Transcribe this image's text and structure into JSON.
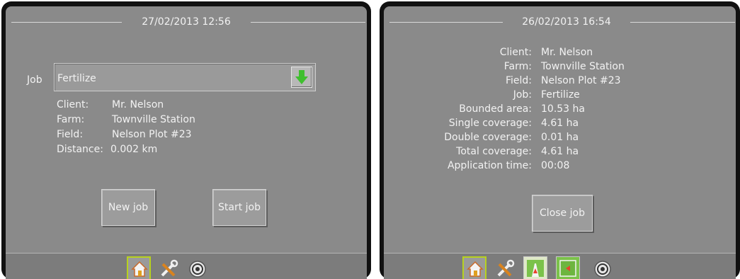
{
  "left_screen": {
    "title": "27/02/2013 12:56",
    "job_label": "Job",
    "job_value": "Fertilize",
    "download_icon": "green-down-arrow-icon",
    "details": [
      {
        "label": "Client:",
        "value": "Mr. Nelson"
      },
      {
        "label": "Farm:",
        "value": "Townville Station"
      },
      {
        "label": "Field:",
        "value": "Nelson Plot #23"
      },
      {
        "label": "Distance:",
        "value": "0.002 km"
      }
    ],
    "new_job_label": "New job",
    "start_job_label": "Start job",
    "tabs": [
      "home-icon",
      "tools-icon",
      "gps-status-icon"
    ]
  },
  "right_screen": {
    "title": "26/02/2013 16:54",
    "details": [
      {
        "label": "Client:",
        "value": "Mr. Nelson"
      },
      {
        "label": "Farm:",
        "value": "Townville Station"
      },
      {
        "label": "Field:",
        "value": "Nelson Plot #23"
      },
      {
        "label": "Job:",
        "value": "Fertilize"
      },
      {
        "label": "Bounded area:",
        "value": "10.53 ha"
      },
      {
        "label": "Single coverage:",
        "value": "4.61 ha"
      },
      {
        "label": "Double coverage:",
        "value": "0.01 ha"
      },
      {
        "label": "Total coverage:",
        "value": "4.61 ha"
      },
      {
        "label": "Application time:",
        "value": "00:08"
      }
    ],
    "close_job_label": "Close job",
    "tabs": [
      "home-icon",
      "tools-icon",
      "vehicle-view-icon",
      "field-view-icon",
      "gps-status-icon"
    ]
  },
  "colors": {
    "active_tab_border": "#b7d11e",
    "arrow_green": "#3fbf2f"
  }
}
